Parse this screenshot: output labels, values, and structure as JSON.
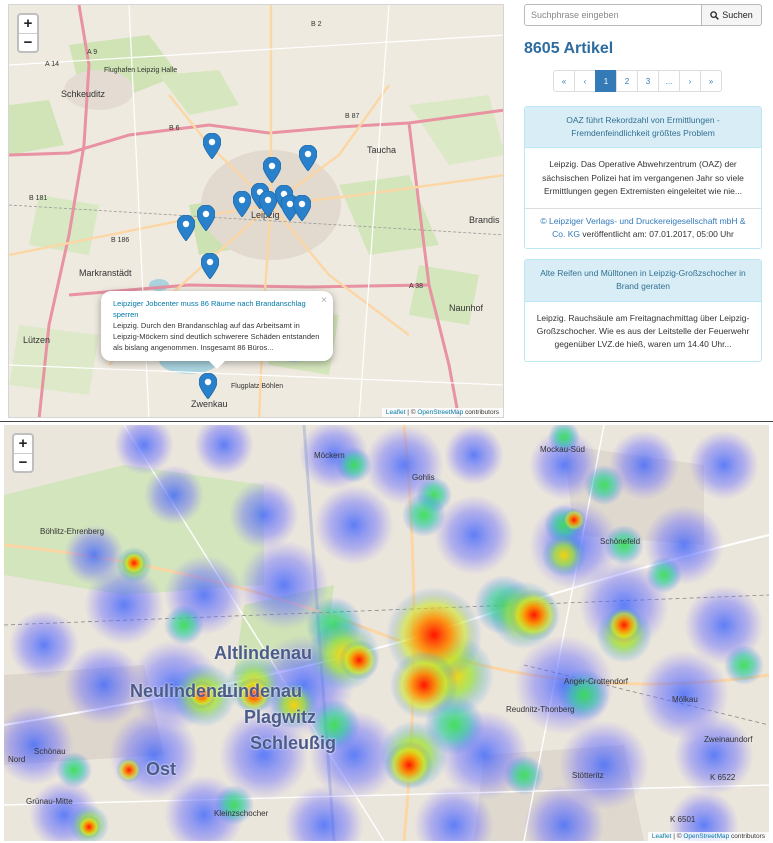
{
  "map_controls": {
    "zoom_in": "+",
    "zoom_out": "−"
  },
  "top_map": {
    "labels": {
      "flughafen": "Flughafen Leipzig Halle",
      "schkeuditz": "Schkeuditz",
      "taucha": "Taucha",
      "leipzig": "Leipzig",
      "brandis": "Brandis",
      "markranstaedt": "Markranstädt",
      "naunhof": "Naunhof",
      "luetzen": "Lützen",
      "zwenkau": "Zwenkau",
      "flugplatz": "Flugplatz Böhlen",
      "a9": "A 9",
      "a14": "A 14",
      "a38": "A 38",
      "b2": "B 2",
      "b6": "B 6",
      "b87": "B 87",
      "b181": "B 181",
      "b186": "B 186"
    },
    "popup": {
      "title": "Leipziger Jobcenter muss 86 Räume nach Brandanschlag sperren",
      "text": "Leipzig. Durch den Brandanschlag auf das Arbeitsamt in Leipzig-Möckern sind deutlich schwerere Schäden entstanden als bislang angenommen. Insgesamt 86 Büros...",
      "close": "×"
    },
    "attribution": {
      "leaflet": "Leaflet",
      "sep": " | © ",
      "osm": "OpenStreetMap",
      "contrib": " contributors"
    }
  },
  "search": {
    "placeholder": "Suchphrase eingeben",
    "button_label": "Suchen",
    "icon": "search-icon"
  },
  "result_count": "8605 Artikel",
  "pagination": {
    "items": [
      "«",
      "‹",
      "1",
      "2",
      "3",
      "...",
      "›",
      "»"
    ],
    "active": "1"
  },
  "articles": [
    {
      "title": "OAZ führt Rekordzahl von Ermittlungen - Fremdenfeindlichkeit größtes Problem",
      "body": "Leipzig. Das Operative Abwehrzentrum (OAZ) der sächsischen Polizei hat im vergangenen Jahr so viele Ermittlungen gegen Extremisten eingeleitet wie nie...",
      "publisher": "© Leipziger Verlags- und Druckereigesellschaft mbH & Co. KG",
      "published": " veröffentlicht am: 07.01.2017, 05:00 Uhr"
    },
    {
      "title": "Alte Reifen und Mülltonen in Leipzig-Großzschocher in Brand geraten",
      "body": "Leipzig. Rauchsäule am Freitagnachmittag über Leipzig-Großzschocher. Wie es aus der Leitstelle der Feuerwehr gegenüber LVZ.de hieß, waren um 14.40 Uhr..."
    }
  ],
  "heatmap": {
    "labels": {
      "altlindenau": "Altlindenau",
      "neulindenau": "Neulindenau",
      "lindenau": "Lindenau",
      "plagwitz": "Plagwitz",
      "schleussig": "Schleußig",
      "ost": "Ost",
      "moeckern": "Möckern",
      "gohlis": "Gohlis",
      "mockau_sued": "Mockau-Süd",
      "boehlitz": "Böhlitz-Ehrenberg",
      "schoenau": "Schönau",
      "gruenau_mitte": "Grünau-Mitte",
      "anger": "Anger-Crottendorf",
      "reudnitz": "Reudnitz-Thonberg",
      "stoetteritz": "Stötteritz",
      "zweinaundorf": "Zweinaundorf",
      "moelkau": "Mölkau",
      "kleinzschocher": "Kleinzschocher",
      "nord": "Nord",
      "schoenefeld": "Schönefeld",
      "k6522": "K 6522",
      "k6501": "K 6501"
    },
    "attribution": {
      "leaflet": "Leaflet",
      "sep": " | © ",
      "osm": "OpenStreetMap",
      "contrib": " contributors"
    }
  }
}
